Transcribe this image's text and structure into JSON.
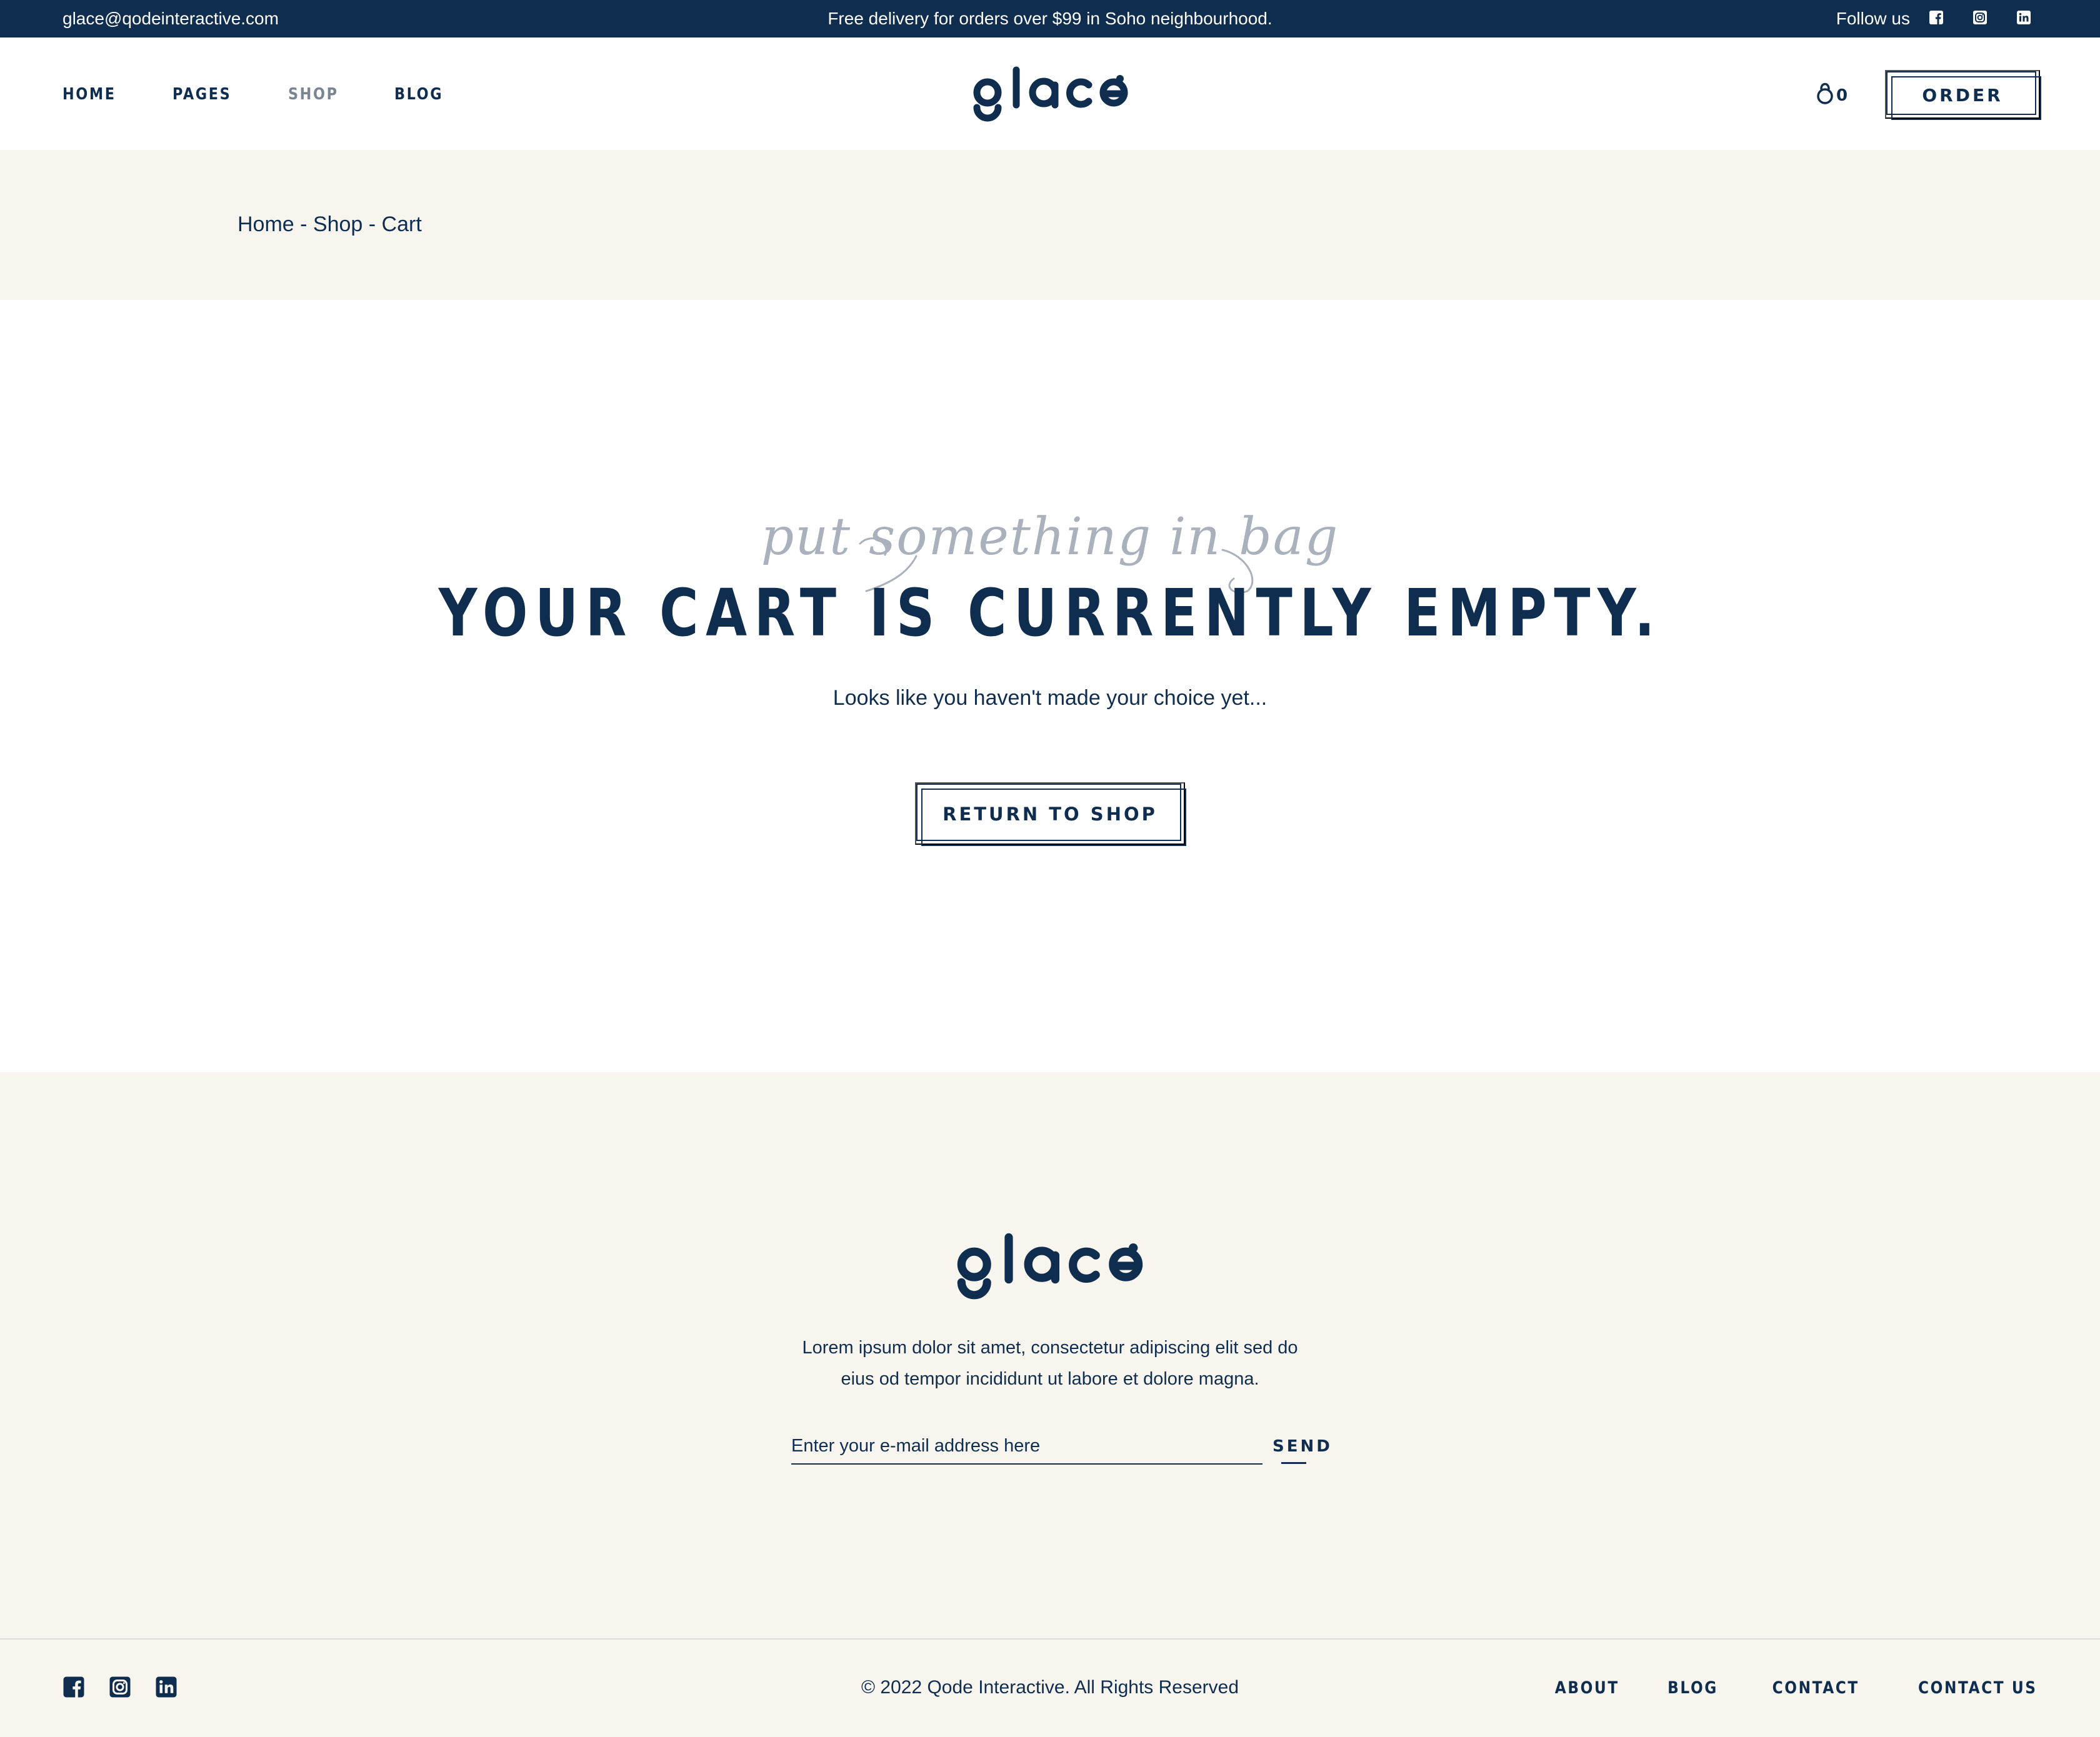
{
  "topbar": {
    "email": "glace@qodeinteractive.com",
    "promo": "Free delivery for orders over $99 in Soho neighbourhood.",
    "follow_label": "Follow us",
    "social_icons": [
      "facebook-icon",
      "instagram-icon",
      "linkedin-icon"
    ]
  },
  "header": {
    "nav": [
      {
        "label": "HOME",
        "active": false
      },
      {
        "label": "PAGES",
        "active": false
      },
      {
        "label": "SHOP",
        "active": true
      },
      {
        "label": "BLOG",
        "active": false
      }
    ],
    "logo_text": "glace",
    "cart_count": "0",
    "order_label": "ORDER"
  },
  "breadcrumb": {
    "items": [
      "Home",
      "Shop",
      "Cart"
    ],
    "separator": " - "
  },
  "cart": {
    "script_title": "put something in bag",
    "heading": "YOUR CART IS CURRENTLY EMPTY.",
    "subtext": "Looks like you haven't made your choice yet...",
    "button_label": "RETURN TO SHOP"
  },
  "footer": {
    "logo_text": "glace",
    "text_line1": "Lorem ipsum dolor sit amet, consectetur adipiscing elit sed do",
    "text_line2": "eius od tempor incididunt ut labore et dolore magna.",
    "email_placeholder": "Enter your e-mail address here",
    "send_label": "SEND",
    "copyright": "© 2022 Qode Interactive. All Rights Reserved",
    "links": [
      "ABOUT",
      "BLOG",
      "CONTACT",
      "CONTACT US"
    ],
    "social_icons": [
      "facebook-icon",
      "instagram-icon",
      "linkedin-icon"
    ]
  },
  "colors": {
    "navy": "#0f2d4f",
    "cream": "#f8f5ef",
    "muted_nav": "#7a8593",
    "script_gray": "#a8b1bc"
  }
}
